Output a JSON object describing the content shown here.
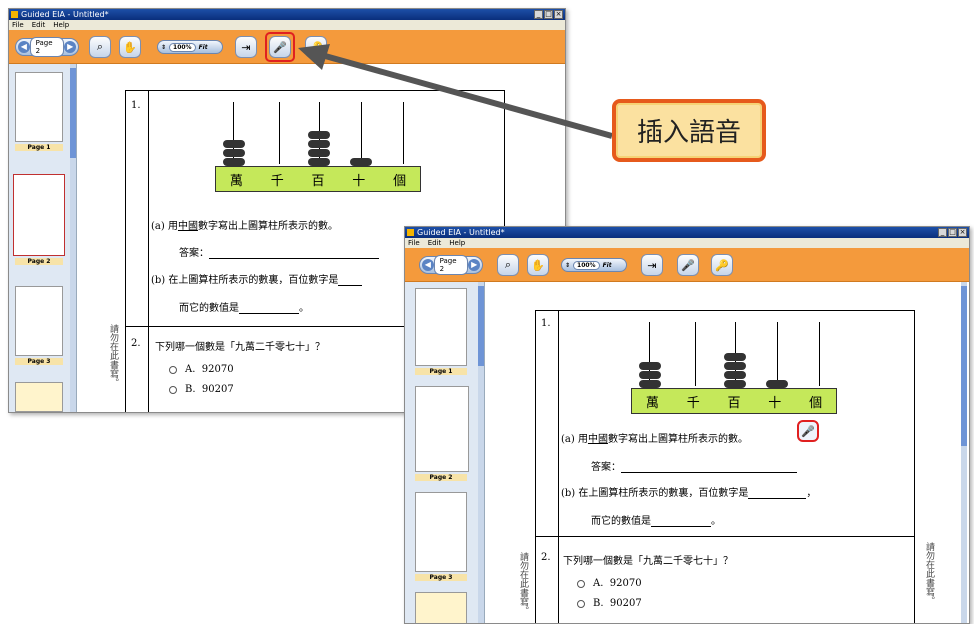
{
  "callout": {
    "text": "插入語音"
  },
  "window1": {
    "title": "Guided EIA - Untitled*",
    "menu": [
      "File",
      "Edit",
      "Help"
    ],
    "page_label": "Page 2",
    "zoom_value": "100%",
    "zoom_fit": "Fit",
    "thumbnails": [
      "Page 1",
      "Page 2",
      "Page 3"
    ]
  },
  "window2": {
    "title": "Guided EIA - Untitled*",
    "menu": [
      "File",
      "Edit",
      "Help"
    ],
    "page_label": "Page 2",
    "zoom_value": "100%",
    "zoom_fit": "Fit",
    "thumbnails": [
      "Page 1",
      "Page 2",
      "Page 3"
    ]
  },
  "doc": {
    "q1_number": "1.",
    "abacus_places": [
      "萬",
      "千",
      "百",
      "十",
      "個"
    ],
    "qa_label": "(a)",
    "qa_prefix": "用",
    "qa_underlined": "中國",
    "qa_rest": "數字寫出上圖算柱所表示的數。",
    "answer_label": "答案：",
    "qb_label": "(b)",
    "qb_text": "在上圖算柱所表示的數裏，百位數字是",
    "qb_line2": "而它的數值是",
    "period": "。",
    "comma": "，",
    "q2_number": "2.",
    "q2_text": "下列哪一個數是「九萬二千零七十」？",
    "optA_label": "A.",
    "optA_value": "92070",
    "optB_label": "B.",
    "optB_value": "90207",
    "margin_note": "請勿在此書寫。"
  },
  "icons": {
    "nav_prev": "arrow-left-icon",
    "nav_next": "arrow-right-icon",
    "select": "pointer-icon",
    "pan": "hand-icon",
    "insert_text": "insert-icon",
    "record": "microphone-icon",
    "help": "key-icon"
  }
}
